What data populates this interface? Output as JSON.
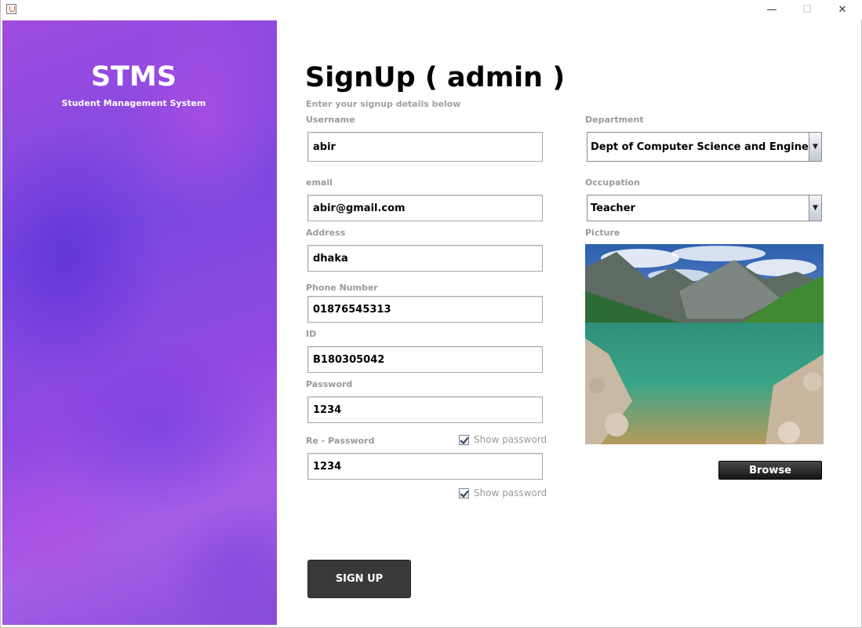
{
  "window": {
    "controls": {
      "minimize": "—",
      "maximize": "☐",
      "close": "✕"
    },
    "icon": "java-app-icon"
  },
  "sidebar": {
    "title": "STMS",
    "subtitle": "Student Management System"
  },
  "form": {
    "heading": "SignUp ( admin )",
    "subheading": "Enter your signup details below",
    "username": {
      "label": "Username",
      "value": "abir"
    },
    "email": {
      "label": "email",
      "value": "abir@gmail.com"
    },
    "address": {
      "label": "Address",
      "value": "dhaka"
    },
    "phone": {
      "label": "Phone Number",
      "value": "01876545313"
    },
    "id": {
      "label": "ID",
      "value": "B180305042"
    },
    "password": {
      "label": "Password",
      "value": "1234",
      "show_label": "Show password",
      "show_checked": true
    },
    "repassword": {
      "label": "Re - Password",
      "value": "1234",
      "show_label": "Show password",
      "show_checked": true
    },
    "department": {
      "label": "Department",
      "value": "Dept of Computer Science and Engineering"
    },
    "occupation": {
      "label": "Occupation",
      "value": "Teacher"
    },
    "picture": {
      "label": "Picture"
    },
    "browse_label": "Browse",
    "signup_label": "SIGN UP"
  },
  "colors": {
    "sidebar_primary": "#8a48e0",
    "sidebar_secondary": "#a05ce6",
    "label_gray": "#9a9a9a",
    "button_dark": "#393939"
  }
}
